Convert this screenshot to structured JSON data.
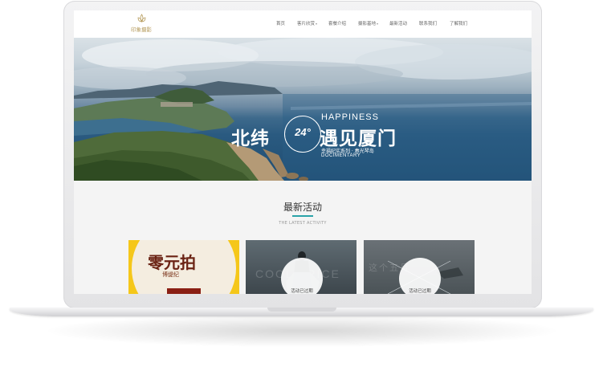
{
  "site": {
    "logo_text": "印象摄影"
  },
  "nav": {
    "items": [
      {
        "label": "首页",
        "has_caret": false
      },
      {
        "label": "客片欣赏",
        "has_caret": true
      },
      {
        "label": "套餐介绍",
        "has_caret": false
      },
      {
        "label": "摄影基地",
        "has_caret": true
      },
      {
        "label": "最新活动",
        "has_caret": false
      },
      {
        "label": "联系我们",
        "has_caret": false
      },
      {
        "label": "了解我们",
        "has_caret": false
      }
    ],
    "caret": "▾"
  },
  "banner": {
    "happiness": "HAPPINESS",
    "title_left": "北纬",
    "badge_number": "24°",
    "title_right": "遇见厦门",
    "series": "幸福纪实系列 · 春光琴岛",
    "documentary": "DOCIMENTARY",
    "slides_count": 3,
    "active_slide": 1
  },
  "activity": {
    "title": "最新活动",
    "subtitle": "THE LATEST ACTIVITY",
    "cards": [
      {
        "title_cn": "零元拍",
        "signature": "博缇纪",
        "status": ""
      },
      {
        "ghost_text": "COOL PRICE",
        "status": "活动已过期"
      },
      {
        "ghost_text": "这个五月",
        "status": "活动已过期"
      }
    ]
  },
  "colors": {
    "accent": "#2aa3a8",
    "logo_gold": "#b59a5a",
    "card1_bg": "#f5c71a"
  }
}
